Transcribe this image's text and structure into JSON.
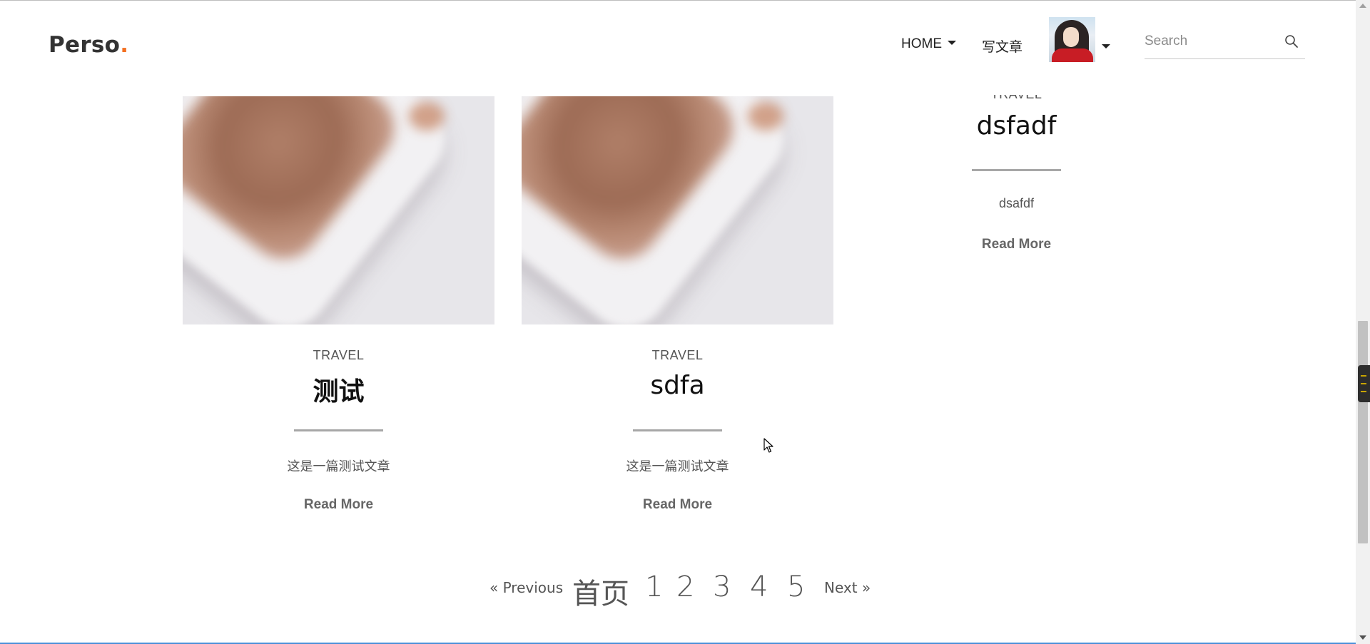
{
  "header": {
    "logo_text": "Perso",
    "logo_dot": ".",
    "nav": {
      "home_label": "HOME",
      "write_label": "写文章"
    },
    "search": {
      "placeholder": "Search"
    }
  },
  "posts": [
    {
      "category": "TRAVEL",
      "title": "dsfadf",
      "excerpt": "dsafdf",
      "read_more": "Read More"
    },
    {
      "category": "TRAVEL",
      "title": "测试",
      "excerpt": "这是一篇测试文章",
      "read_more": "Read More"
    },
    {
      "category": "TRAVEL",
      "title": "sdfa",
      "excerpt": "这是一篇测试文章",
      "read_more": "Read More"
    }
  ],
  "pagination": {
    "previous": "« Previous",
    "first": "首页",
    "pages": [
      "1",
      "2",
      "3",
      "4",
      "5"
    ],
    "next": "Next »"
  },
  "colors": {
    "accent": "#f37021",
    "divider": "#a7a7a7",
    "text": "#333333"
  }
}
